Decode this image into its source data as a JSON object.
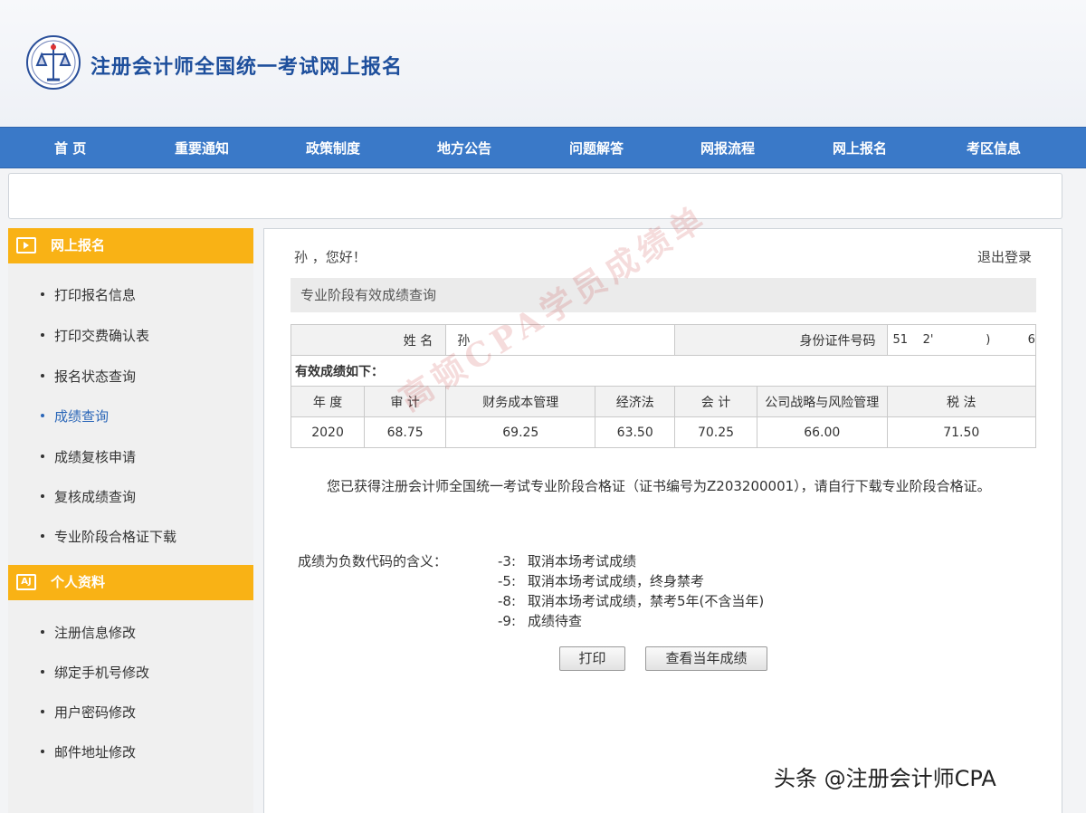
{
  "header": {
    "site_title": "注册会计师全国统一考试网上报名"
  },
  "nav": {
    "items": [
      "首 页",
      "重要通知",
      "政策制度",
      "地方公告",
      "问题解答",
      "网报流程",
      "网上报名",
      "考区信息"
    ]
  },
  "sidebar": {
    "section1_title": "网上报名",
    "section1_items": [
      "打印报名信息",
      "打印交费确认表",
      "报名状态查询",
      "成绩查询",
      "成绩复核申请",
      "复核成绩查询",
      "专业阶段合格证下载"
    ],
    "active_item": "成绩查询",
    "section2_title": "个人资料",
    "section2_icon_text": "AJ",
    "section2_items": [
      "注册信息修改",
      "绑定手机号修改",
      "用户密码修改",
      "邮件地址修改"
    ]
  },
  "main": {
    "greeting": "孙    ，您好！",
    "logout": "退出登录",
    "section_title": "专业阶段有效成绩查询",
    "name_label": "姓      名",
    "name_value": "孙",
    "id_label": "身份证件号码",
    "id_value": "51    2'              )          6",
    "valid_scores_label": "有效成绩如下：",
    "score_headers": [
      "年 度",
      "审 计",
      "财务成本管理",
      "经济法",
      "会 计",
      "公司战略与风险管理",
      "税 法"
    ],
    "score_rows": [
      [
        "2020",
        "68.75",
        "69.25",
        "63.50",
        "70.25",
        "66.00",
        "71.50"
      ]
    ],
    "notice": "您已获得注册会计师全国统一考试专业阶段合格证（证书编号为Z203200001），请自行下载专业阶段合格证。",
    "code_label": "成绩为负数代码的含义：",
    "codes": [
      {
        "code": "-3:",
        "meaning": "取消本场考试成绩"
      },
      {
        "code": "-5:",
        "meaning": "取消本场考试成绩，终身禁考"
      },
      {
        "code": "-8:",
        "meaning": "取消本场考试成绩，禁考5年(不含当年)"
      },
      {
        "code": "-9:",
        "meaning": "成绩待查"
      }
    ],
    "print_button": "打印",
    "view_year_button": "查看当年成绩"
  },
  "watermark_text": "高顿CPA学员成绩单",
  "corner_watermark": "头条 @注册会计师CPA",
  "colors": {
    "nav_bg": "#3a79c8",
    "title_blue": "#1e4f9c",
    "sidebar_header": "#f9b215",
    "active_link": "#2a66b8"
  }
}
